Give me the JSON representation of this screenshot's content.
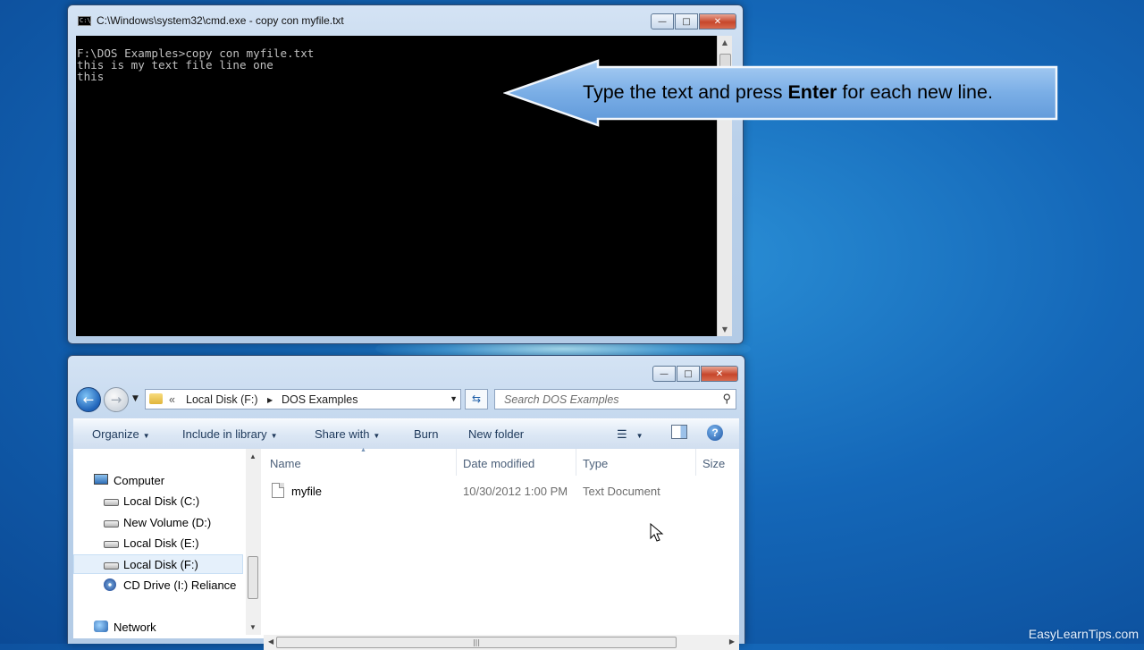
{
  "cmd_window": {
    "title": "C:\\Windows\\system32\\cmd.exe - copy  con myfile.txt",
    "console_lines": [
      "F:\\DOS Examples>copy con myfile.txt",
      "this is my text file line one",
      "this"
    ]
  },
  "callout": {
    "text_before": "Type the text and press ",
    "text_bold": "Enter",
    "text_after": " for each new line."
  },
  "explorer": {
    "breadcrumb": {
      "overflow": "«",
      "segments": [
        "Local Disk (F:)",
        "DOS Examples"
      ]
    },
    "search_placeholder": "Search DOS Examples",
    "toolbar": {
      "organize": "Organize",
      "include_in_library": "Include in library",
      "share_with": "Share with",
      "burn": "Burn",
      "new_folder": "New folder"
    },
    "nav_pane": {
      "items": [
        {
          "label": "Computer",
          "icon": "computer-icon"
        },
        {
          "label": "Local Disk (C:)",
          "icon": "windows-drive-icon"
        },
        {
          "label": "New Volume (D:)",
          "icon": "drive-icon"
        },
        {
          "label": "Local Disk (E:)",
          "icon": "drive-icon"
        },
        {
          "label": "Local Disk (F:)",
          "icon": "drive-icon",
          "selected": true
        },
        {
          "label": "CD Drive (I:) Reliance",
          "icon": "cd-drive-icon"
        },
        {
          "label": "Network",
          "icon": "network-icon"
        }
      ]
    },
    "columns": {
      "name": "Name",
      "date_modified": "Date modified",
      "type": "Type",
      "size": "Size"
    },
    "files": [
      {
        "name": "myfile",
        "date_modified": "10/30/2012 1:00 PM",
        "type": "Text Document",
        "icon": "text-file-icon"
      }
    ]
  },
  "watermark": "EasyLearnTips.com",
  "colors": {
    "desktop_blue": "#1467b8",
    "console_bg": "#000000",
    "console_fg": "#c0c0c0",
    "callout_fill": "#79aee6",
    "selection": "#e5f0fb"
  }
}
